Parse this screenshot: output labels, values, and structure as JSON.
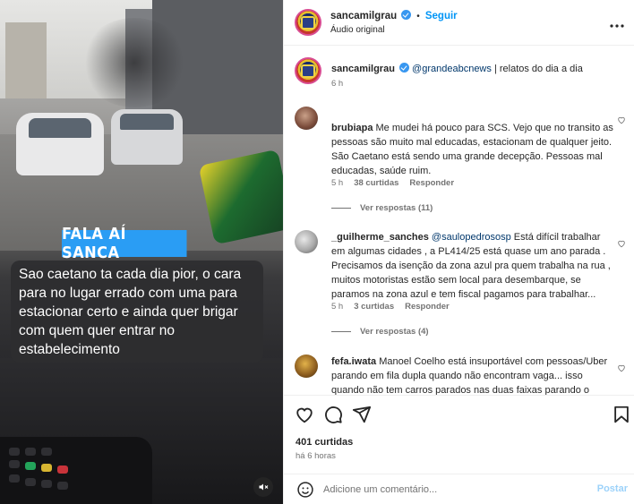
{
  "media": {
    "overlay_title": "FALA AÍ SANCA",
    "caption": "Sao caetano ta cada dia pior, o cara para no lugar errado com uma para estacionar certo e ainda quer brigar com quem quer entrar no estabelecimento",
    "mute_icon": "speaker-muted-icon"
  },
  "header": {
    "username": "sancamilgrau",
    "separator": "•",
    "follow_label": "Seguir",
    "audio_label": "Áudio original",
    "more_icon": "more-horizontal-icon"
  },
  "caption_post": {
    "username": "sancamilgrau",
    "mention": "@grandeabcnews",
    "text": " | relatos do dia a dia",
    "time": "6 h"
  },
  "comments": [
    {
      "username": "brubiapa",
      "mention": "",
      "text": " Me mudei há pouco para SCS. Vejo que no transito as pessoas são muito mal educadas, estacionam de qualquer jeito.\nSão Caetano está sendo uma grande decepção. Pessoas mal educadas, saúde ruim.",
      "time": "5 h",
      "likes": "38 curtidas",
      "reply": "Responder",
      "view_replies": "Ver respostas (11)"
    },
    {
      "username": "_guilherme_sanches",
      "mention": "@saulopedrososp",
      "text": " Está difícil trabalhar em algumas cidades , a PL414/25 está quase um ano parada . Precisamos da isenção da zona azul pra quem trabalha na rua , muitos motoristas estão sem local para desembarque, se paramos na zona azul e tem fiscal pagamos para trabalhar...",
      "time": "5 h",
      "likes": "3 curtidas",
      "reply": "Responder",
      "view_replies": "Ver respostas (4)"
    },
    {
      "username": "fefa.iwata",
      "mention": "",
      "text": " Manoel Coelho está insuportável com pessoas/Uber parando em fila dupla quando não encontram vaga... isso quando não tem carros parados nas duas faixas parando o",
      "time": "",
      "likes": "",
      "reply": "",
      "view_replies": ""
    }
  ],
  "actions": {
    "like_icon": "heart-icon",
    "comment_icon": "comment-icon",
    "share_icon": "send-icon",
    "save_icon": "bookmark-icon",
    "likes_count": "401 curtidas",
    "time_ago": "há 6 horas"
  },
  "add_comment": {
    "emoji_icon": "emoji-icon",
    "placeholder": "Adicione um comentário...",
    "post_label": "Postar"
  },
  "colors": {
    "accent": "#0095f6",
    "verified": "#3897f0",
    "overlay_blue": "#2a9df4",
    "muted_text": "#737373"
  }
}
